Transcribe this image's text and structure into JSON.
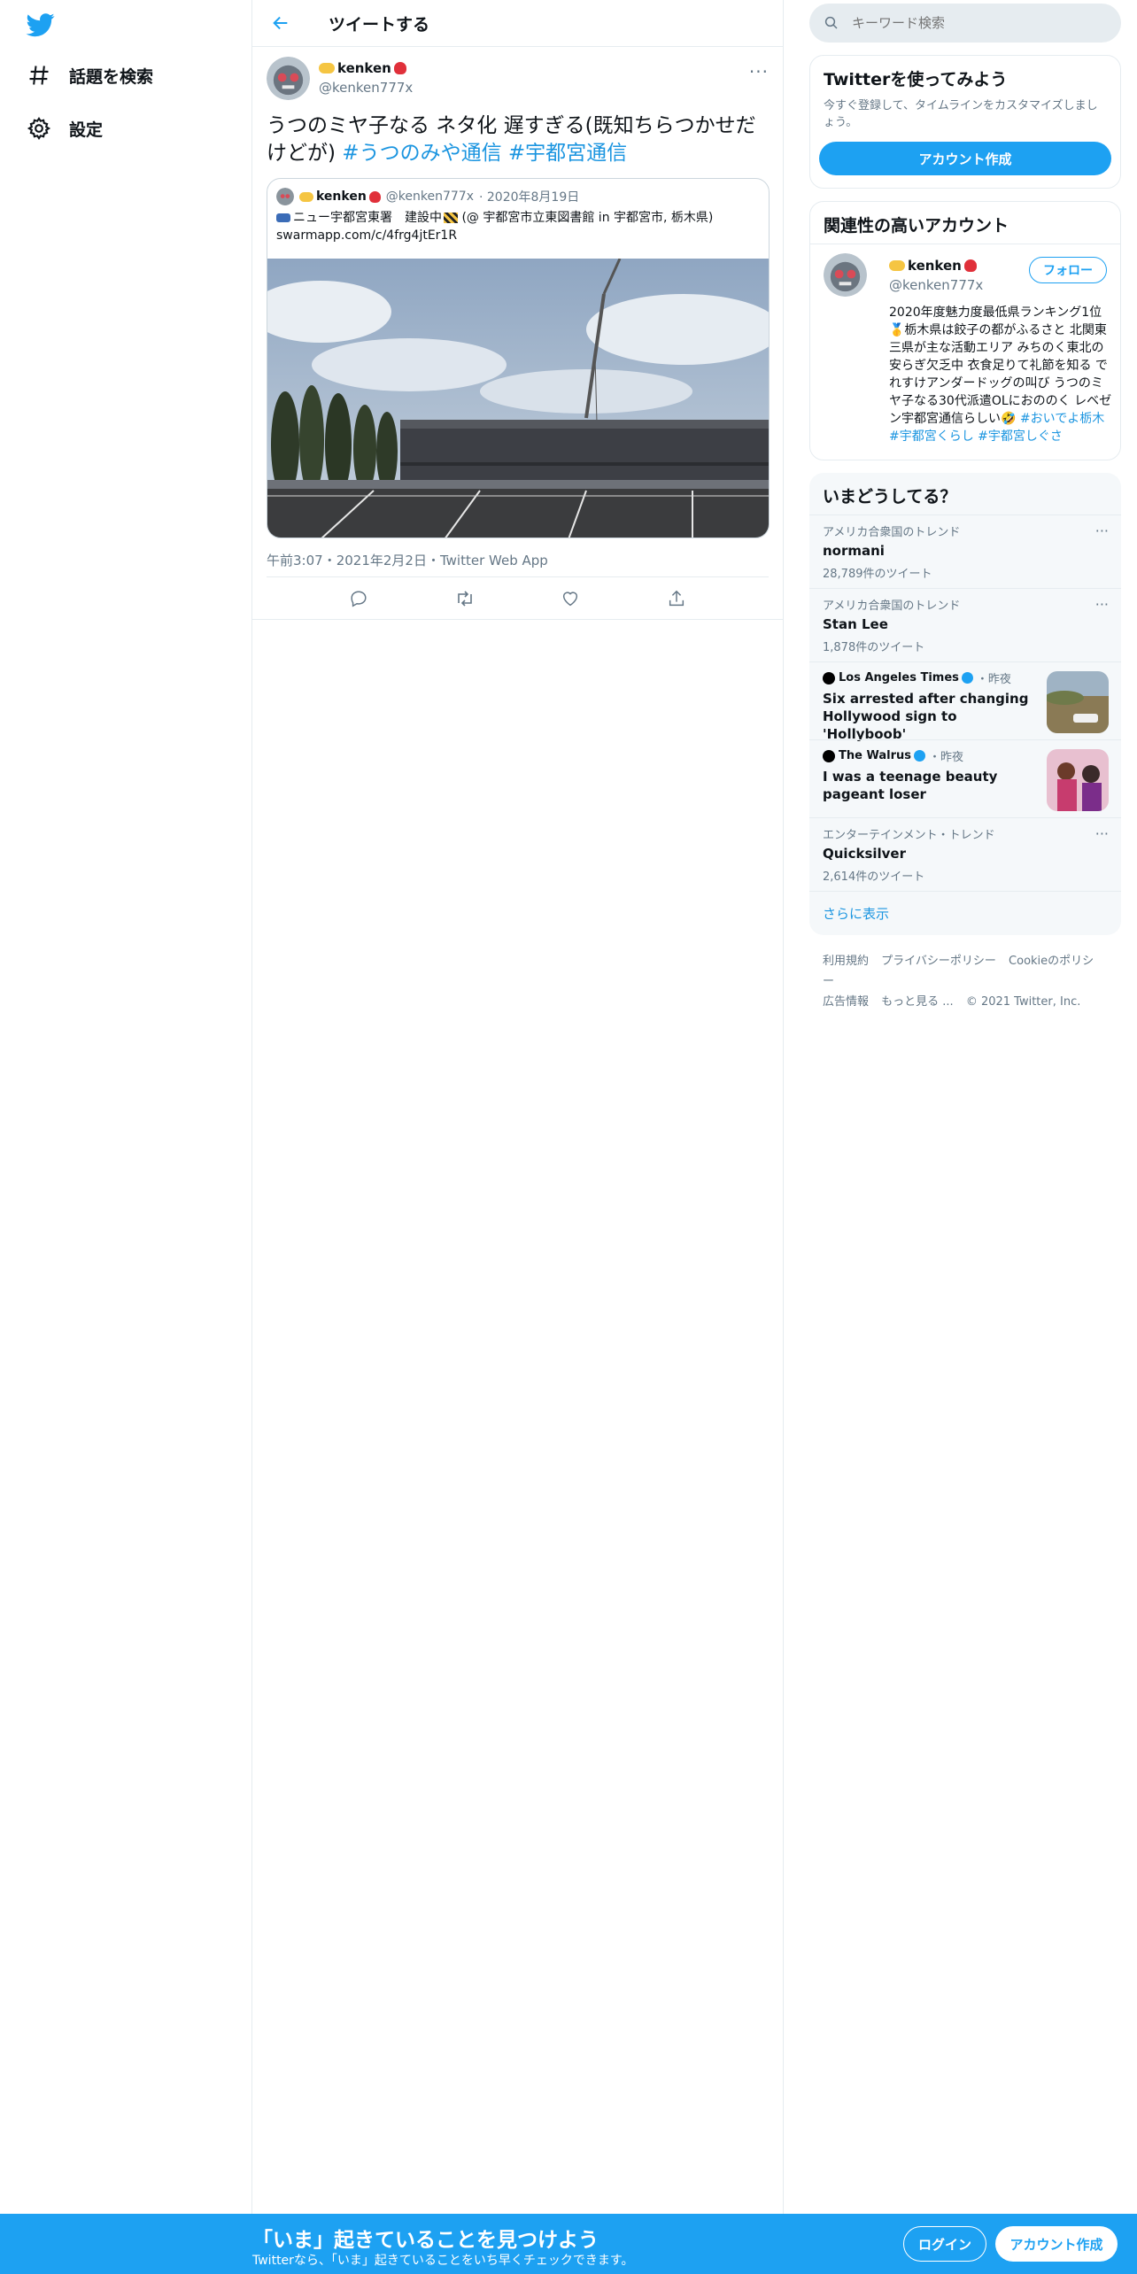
{
  "colors": {
    "accent": "#1da1f2",
    "link": "#1b95e0",
    "muted": "#657786",
    "border": "#e6ecf0"
  },
  "nav": {
    "logo_icon": "twitter-bird-icon",
    "explore_label": "話題を検索",
    "settings_label": "設定"
  },
  "header": {
    "title": "ツイートする"
  },
  "tweet": {
    "display_name": "kenken",
    "handle": "@kenken777x",
    "more": "···",
    "text_main": "うつのミヤ子なる ネタ化 遅すぎる(既知ちらつかせだけどが)  ",
    "hashtag1": "#うつのみや通信",
    "hashtag2": "#宇都宮通信",
    "meta_time": "午前3:07",
    "meta_date": "2021年2月2日",
    "meta_source": "Twitter Web App",
    "separator": "・"
  },
  "quote": {
    "display_name": "kenken",
    "handle": "@kenken777x",
    "date": "· 2020年8月19日",
    "line1": "ニュー宇都宮東署　建設中",
    "line1_suffix": " (@ 宇都宮市立東図書館 in 宇都宮市, 栃木県)",
    "line2": "swarmapp.com/c/4frg4jtEr1R"
  },
  "search": {
    "placeholder": "キーワード検索"
  },
  "signup_card": {
    "title": "Twitterを使ってみよう",
    "subtitle": "今すぐ登録して、タイムラインをカスタマイズしましょう。",
    "button": "アカウント作成"
  },
  "relevant": {
    "title": "関連性の高いアカウント",
    "display_name": "kenken",
    "handle": "@kenken777x",
    "follow": "フォロー",
    "bio_text": "2020年度魅力度最低県ランキング1位🥇栃木県は餃子の都がふるさと 北関東三県が主な活動エリア みちのく東北の安らぎ欠乏中 衣食足りて礼節を知る でれすけアンダードッグの叫び うつのミヤ子なる30代派遣OLにおののく レベゼン宇都宮通信らしい🤣 ",
    "bio_tags": "#おいでよ栃木 #宇都宮くらし #宇都宮しぐさ"
  },
  "trends": {
    "title": "いまどうしてる？",
    "items": [
      {
        "category": "アメリカ合衆国のトレンド",
        "name": "normani",
        "count": "28,789件のツイート"
      },
      {
        "category": "アメリカ合衆国のトレンド",
        "name": "Stan Lee",
        "count": "1,878件のツイート"
      }
    ],
    "news": [
      {
        "source": "Los Angeles Times",
        "time": "・昨夜",
        "title": "Six arrested after changing Hollywood sign to 'Hollyboob'"
      },
      {
        "source": "The Walrus",
        "time": "・昨夜",
        "title": "I was a teenage beauty pageant loser"
      }
    ],
    "last": {
      "category": "エンターテインメント・トレンド",
      "name": "Quicksilver",
      "count": "2,614件のツイート"
    },
    "show_more": "さらに表示"
  },
  "footer": {
    "terms": "利用規約",
    "privacy": "プライバシーポリシー",
    "cookie": "Cookieのポリシー",
    "ads": "広告情報",
    "more": "もっと見る ...",
    "copyright": "© 2021 Twitter, Inc."
  },
  "bottombar": {
    "title": "「いま」起きていることを見つけよう",
    "subtitle": "Twitterなら、「いま」起きていることをいち早くチェックできます。",
    "login": "ログイン",
    "signup": "アカウント作成"
  }
}
